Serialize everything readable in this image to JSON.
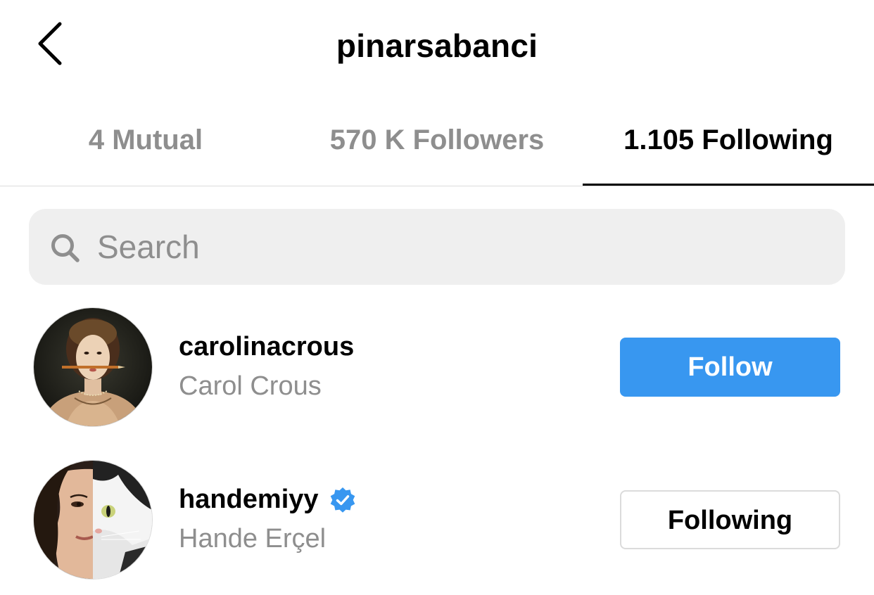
{
  "header": {
    "title": "pinarsabanci",
    "back_icon": "chevron-left-icon"
  },
  "tabs": [
    {
      "label": "4 Mutual",
      "active": false
    },
    {
      "label": "570 K Followers",
      "active": false
    },
    {
      "label": "1.105 Following",
      "active": true
    }
  ],
  "search": {
    "placeholder": "Search",
    "value": "",
    "icon": "search-icon"
  },
  "list": [
    {
      "username": "carolinacrous",
      "full_name": "Carol Crous",
      "verified": false,
      "button_label": "Follow",
      "button_style": "primary"
    },
    {
      "username": "handemiyy",
      "full_name": "Hande Erçel",
      "verified": true,
      "button_label": "Following",
      "button_style": "secondary"
    }
  ],
  "colors": {
    "accent": "#3897f0",
    "verified": "#3897f0",
    "muted_text": "#8e8e8e",
    "search_bg": "#efefef",
    "divider": "#dbdbdb"
  }
}
